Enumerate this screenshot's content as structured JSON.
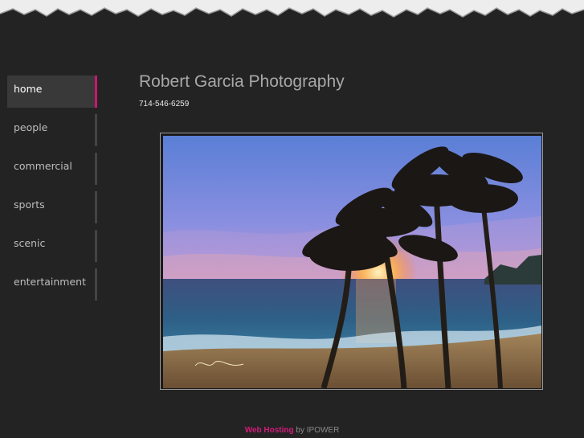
{
  "site": {
    "title": "Robert Garcia Photography",
    "phone": "714-546-6259"
  },
  "nav": {
    "items": [
      {
        "label": "home",
        "active": true
      },
      {
        "label": "people",
        "active": false
      },
      {
        "label": "commercial",
        "active": false
      },
      {
        "label": "sports",
        "active": false
      },
      {
        "label": "scenic",
        "active": false
      },
      {
        "label": "entertainment",
        "active": false
      }
    ]
  },
  "photo": {
    "subject": "sunset palm trees beach photograph",
    "signature": "Robert Garcia"
  },
  "footer": {
    "link_text": "Web Hosting",
    "connector": "by",
    "provider": "IPOWER"
  },
  "colors": {
    "background": "#232323",
    "accent": "#c8186e",
    "link": "#d01c79"
  }
}
